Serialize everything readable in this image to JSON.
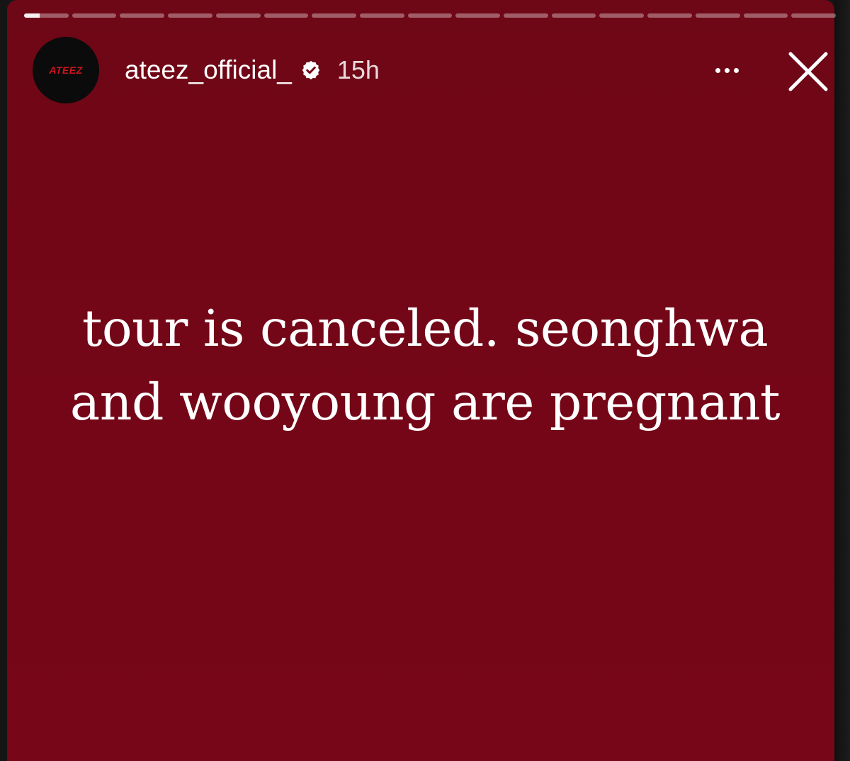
{
  "story": {
    "background_color": "#760618",
    "progress_segments": 17,
    "active_segment": 1
  },
  "header": {
    "avatar_text": "ATEEZ",
    "username": "ateez_official_",
    "verified_icon": "verified-badge-icon",
    "time_ago": "15h",
    "more_icon": "more-horizontal-icon",
    "close_icon": "close-icon"
  },
  "caption": {
    "line1": "tour is canceled. seonghwa",
    "line2": "and wooyoung are pregnant"
  }
}
